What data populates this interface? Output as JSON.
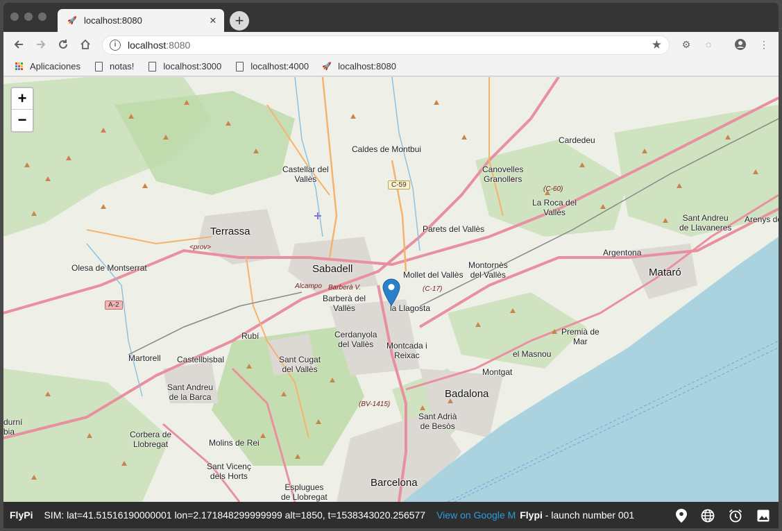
{
  "browser": {
    "tab_title": "localhost:8080",
    "address_host": "localhost",
    "address_port": ":8080",
    "bookmarks": [
      {
        "label": "Aplicaciones",
        "icon": "apps-grid-icon"
      },
      {
        "label": "notas!",
        "icon": "page-icon"
      },
      {
        "label": "localhost:3000",
        "icon": "page-icon"
      },
      {
        "label": "localhost:4000",
        "icon": "page-icon"
      },
      {
        "label": "localhost:8080",
        "icon": "rocket-icon"
      }
    ]
  },
  "map": {
    "zoom_in": "+",
    "zoom_out": "−",
    "places": {
      "terrassa": "Terrassa",
      "sabadell": "Sabadell",
      "badalona": "Badalona",
      "barcelona": "Barcelona",
      "mataro": "Mataró",
      "castellar": "Castellar del\nVallès",
      "caldes": "Caldes de Montbui",
      "canovelles": "Canovelles\nGranollers",
      "cardedeu": "Cardedeu",
      "la_roca": "La Roca del\nVallès",
      "parets": "Parets del Vallès",
      "mollet": "Mollet del Vallès",
      "montornes": "Montornès\ndel Vallès",
      "barbera": "Barberà del\nVallès",
      "la_llagosta": "la Llagosta",
      "olesa": "Olesa de Montserrat",
      "rubi": "Rubí",
      "cerdanyola": "Cerdanyola\ndel Vallès",
      "montcada": "Montcada i\nReixac",
      "sant_cugat": "Sant Cugat\ndel Vallès",
      "martorell": "Martorell",
      "castellbisbal": "Castellbisbal",
      "sant_andreu_barca": "Sant Andreu\nde la Barca",
      "corbera": "Corbera de\nLlobregat",
      "molins": "Molins de Rei",
      "sant_vicenc": "Sant Vicenç\ndels Horts",
      "esplugues": "Esplugues\nde Llobregat",
      "sant_adria": "Sant Adrià\nde Besòs",
      "montgat": "Montgat",
      "el_masnou": "el Masnou",
      "premia": "Premià de\nMar",
      "argentona": "Argentona",
      "sant_andreu_llavaneres": "Sant Andreu\nde Llavaneres",
      "arenys": "Arenys de",
      "durni": "durní\nbia"
    },
    "road_labels": {
      "c59": "C-59",
      "a2": "A-2",
      "c17": "(C-17)",
      "c60": "(C-60)",
      "bv1415": "(BV-1415)",
      "prov": "<prov>",
      "alcampo": "Alcampo",
      "barbera_v": "Barberà V."
    }
  },
  "statusbar": {
    "app_name": "FlyPi",
    "sim_text": "SIM: lat=41.51516190000001 lon=2.171848299999999 alt=1850, t=1538343020.256577",
    "gmaps_link": "View on Google M",
    "launch_app": "Flypi",
    "launch_text": "- launch number 001",
    "icons": [
      "location-pin-icon",
      "globe-icon",
      "alarm-clock-icon",
      "image-icon"
    ]
  },
  "colors": {
    "water": "#aad3df",
    "forest": "#a9d49a",
    "urban": "#d9d6d2",
    "motorway": "#e8909f",
    "primary_road": "#f6b26b",
    "marker": "#2a81cb",
    "link": "#2d9cdb"
  }
}
